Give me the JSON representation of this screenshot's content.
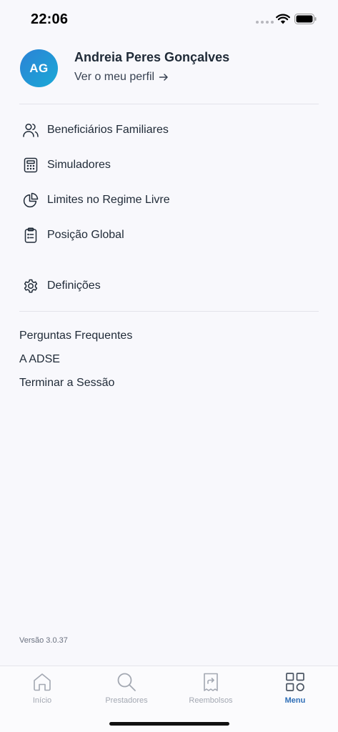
{
  "status_bar": {
    "time": "22:06"
  },
  "profile": {
    "initials": "AG",
    "name": "Andreia Peres Gonçalves",
    "link_label": "Ver o meu perfil",
    "arrow_icon": "arrow-right-icon",
    "avatar_gradient": [
      "#2b82d6",
      "#1aa9d6"
    ]
  },
  "menu": {
    "items": [
      {
        "label": "Beneficiários Familiares",
        "icon": "users-icon"
      },
      {
        "label": "Simuladores",
        "icon": "calculator-icon"
      },
      {
        "label": "Limites no Regime Livre",
        "icon": "pie-chart-icon"
      },
      {
        "label": "Posição Global",
        "icon": "clipboard-list-icon"
      }
    ],
    "settings": {
      "label": "Definições",
      "icon": "gear-icon"
    }
  },
  "links": [
    {
      "label": "Perguntas Frequentes"
    },
    {
      "label": "A ADSE"
    },
    {
      "label": "Terminar a Sessão"
    }
  ],
  "version": "Versão 3.0.37",
  "tab_bar": {
    "tabs": [
      {
        "label": "Início",
        "icon": "home-icon",
        "active": false
      },
      {
        "label": "Prestadores",
        "icon": "search-icon",
        "active": false
      },
      {
        "label": "Reembolsos",
        "icon": "receipt-icon",
        "active": false
      },
      {
        "label": "Menu",
        "icon": "grid-icon",
        "active": true
      }
    ],
    "active_color": "#2f6fb7",
    "inactive_color": "#a3a8b2"
  }
}
